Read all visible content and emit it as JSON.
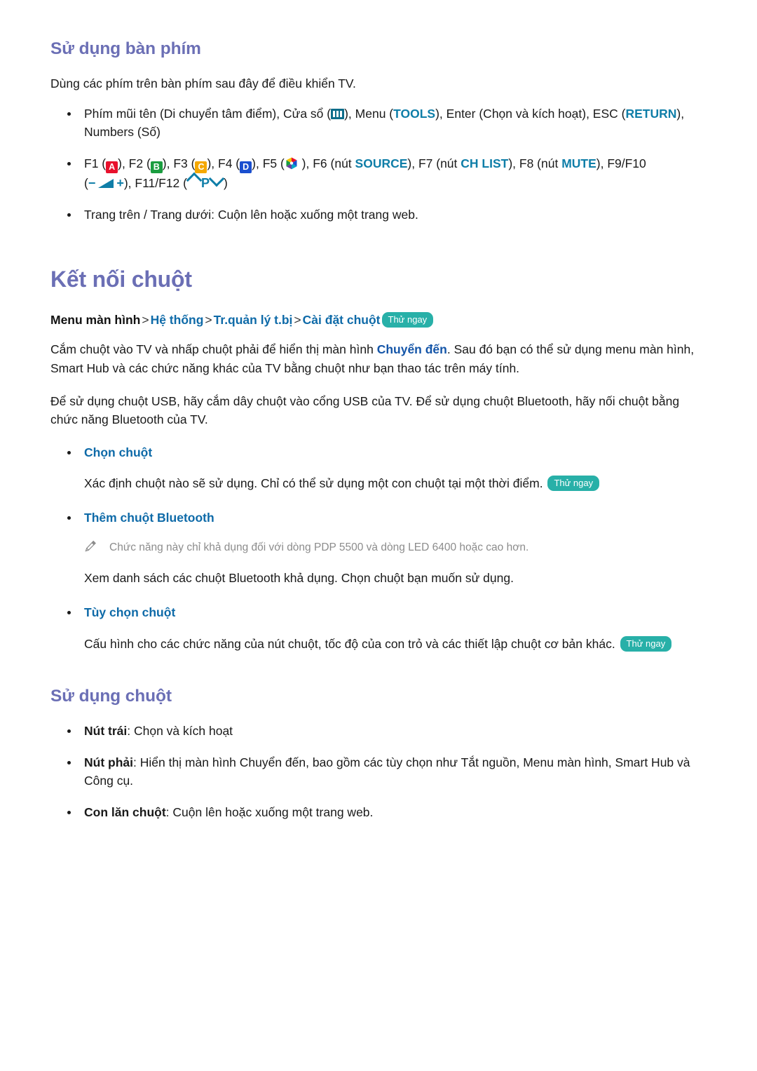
{
  "sections": {
    "keyboard": {
      "heading": "Sử dụng bàn phím",
      "intro": "Dùng các phím trên bàn phím sau đây để điều khiển TV.",
      "bullets": {
        "arrow_keys": {
          "pre": "Phím mũi tên (Di chuyển tâm điểm), Cửa sổ (",
          "mid1": "), Menu (",
          "tools": "TOOLS",
          "mid2": "), Enter (Chọn và kích hoạt), ESC (",
          "return": "RETURN",
          "post": "),",
          "line2": "Numbers (Số)"
        },
        "function_keys": {
          "f1": "F1 (",
          "key_a": "A",
          "f2": "), F2 (",
          "key_b": "B",
          "f3": "), F3 (",
          "key_c": "C",
          "f4": "), F4 (",
          "key_d": "D",
          "f5": "), F5 (",
          "f6": " ), F6 (nút ",
          "source": "SOURCE",
          "f7": "), F7 (nút ",
          "chlist": "CH LIST",
          "f8": "), F8 (nút ",
          "mute": "MUTE",
          "f9f10": "), F9/F10",
          "line2_open": "(",
          "minus": "−",
          "plus": "+",
          "line2_mid": "), F11/F12 (",
          "p_label": "P",
          "line2_close": ")"
        },
        "page_scroll": "Trang trên / Trang dưới: Cuộn lên hoặc xuống một trang web."
      }
    },
    "mouse_connect": {
      "heading": "Kết nối chuột",
      "breadcrumb": {
        "root": "Menu màn hình",
        "sep": ">",
        "item1": "Hệ thống",
        "item2": "Tr.quản lý t.bị",
        "item3": "Cài đặt chuột",
        "badge": "Thử ngay"
      },
      "para1_a": "Cắm chuột vào TV và nhấp chuột phải để hiển thị màn hình ",
      "para1_kw": "Chuyển đến",
      "para1_b": ". Sau đó bạn có thể sử dụng menu màn hình, Smart Hub và các chức năng khác của TV bằng chuột như bạn thao tác trên máy tính.",
      "para2": "Để sử dụng chuột USB, hãy cắm dây chuột vào cổng USB của TV. Để sử dụng chuột Bluetooth, hãy nối chuột bằng chức năng Bluetooth của TV.",
      "items": {
        "select_mouse": {
          "title": "Chọn chuột",
          "body": "Xác định chuột nào sẽ sử dụng. Chỉ có thể sử dụng một con chuột tại một thời điểm. ",
          "badge": "Thử ngay"
        },
        "add_bt_mouse": {
          "title": "Thêm chuột Bluetooth",
          "note": "Chức năng này chỉ khả dụng đối với dòng PDP 5500 và dòng LED 6400 hoặc cao hơn.",
          "body": "Xem danh sách các chuột Bluetooth khả dụng. Chọn chuột bạn muốn sử dụng."
        },
        "mouse_options": {
          "title": "Tùy chọn chuột",
          "body": "Cấu hình cho các chức năng của nút chuột, tốc độ của con trỏ và các thiết lập chuột cơ bản khác. ",
          "badge": "Thử ngay"
        }
      }
    },
    "mouse_usage": {
      "heading": "Sử dụng chuột",
      "bullets": {
        "left": {
          "label": "Nút trái",
          "text": ": Chọn và kích hoạt"
        },
        "right": {
          "label": "Nút phải",
          "text": ": Hiển thị màn hình Chuyển đến, bao gồm các tùy chọn như Tắt nguồn, Menu màn hình, Smart Hub và Công cụ."
        },
        "wheel": {
          "label": "Con lăn chuột",
          "text": ": Cuộn lên hoặc xuống một trang web."
        }
      }
    }
  },
  "icons": {
    "window": "window-panel-icon",
    "smart_hub": "smart-hub-cube-icon",
    "pencil": "pencil-note-icon",
    "volume": "volume-triangle-icon",
    "channel_up": "chevron-up-icon",
    "channel_down": "chevron-down-icon"
  },
  "colors": {
    "heading_purple": "#6b6fb5",
    "link_teal": "#0e6aa8",
    "keyword_teal": "#0f7ea8",
    "keyword_blue": "#1455a8",
    "badge_bg": "#28b0a8",
    "note_gray": "#8c8c8c",
    "key_a": "#e8112d",
    "key_b": "#1a9d3f",
    "key_c": "#f5a800",
    "key_d": "#1a4fcf"
  }
}
